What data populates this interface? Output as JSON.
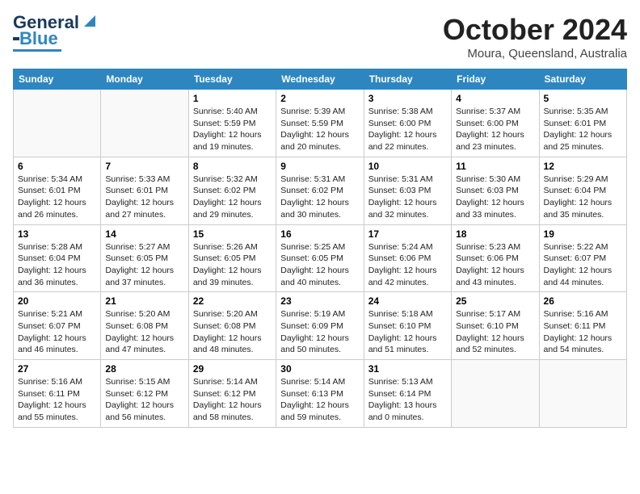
{
  "logo": {
    "line1": "General",
    "line2": "Blue"
  },
  "title": "October 2024",
  "location": "Moura, Queensland, Australia",
  "weekdays": [
    "Sunday",
    "Monday",
    "Tuesday",
    "Wednesday",
    "Thursday",
    "Friday",
    "Saturday"
  ],
  "weeks": [
    [
      {
        "day": "",
        "info": ""
      },
      {
        "day": "",
        "info": ""
      },
      {
        "day": "1",
        "info": "Sunrise: 5:40 AM\nSunset: 5:59 PM\nDaylight: 12 hours\nand 19 minutes."
      },
      {
        "day": "2",
        "info": "Sunrise: 5:39 AM\nSunset: 5:59 PM\nDaylight: 12 hours\nand 20 minutes."
      },
      {
        "day": "3",
        "info": "Sunrise: 5:38 AM\nSunset: 6:00 PM\nDaylight: 12 hours\nand 22 minutes."
      },
      {
        "day": "4",
        "info": "Sunrise: 5:37 AM\nSunset: 6:00 PM\nDaylight: 12 hours\nand 23 minutes."
      },
      {
        "day": "5",
        "info": "Sunrise: 5:35 AM\nSunset: 6:01 PM\nDaylight: 12 hours\nand 25 minutes."
      }
    ],
    [
      {
        "day": "6",
        "info": "Sunrise: 5:34 AM\nSunset: 6:01 PM\nDaylight: 12 hours\nand 26 minutes."
      },
      {
        "day": "7",
        "info": "Sunrise: 5:33 AM\nSunset: 6:01 PM\nDaylight: 12 hours\nand 27 minutes."
      },
      {
        "day": "8",
        "info": "Sunrise: 5:32 AM\nSunset: 6:02 PM\nDaylight: 12 hours\nand 29 minutes."
      },
      {
        "day": "9",
        "info": "Sunrise: 5:31 AM\nSunset: 6:02 PM\nDaylight: 12 hours\nand 30 minutes."
      },
      {
        "day": "10",
        "info": "Sunrise: 5:31 AM\nSunset: 6:03 PM\nDaylight: 12 hours\nand 32 minutes."
      },
      {
        "day": "11",
        "info": "Sunrise: 5:30 AM\nSunset: 6:03 PM\nDaylight: 12 hours\nand 33 minutes."
      },
      {
        "day": "12",
        "info": "Sunrise: 5:29 AM\nSunset: 6:04 PM\nDaylight: 12 hours\nand 35 minutes."
      }
    ],
    [
      {
        "day": "13",
        "info": "Sunrise: 5:28 AM\nSunset: 6:04 PM\nDaylight: 12 hours\nand 36 minutes."
      },
      {
        "day": "14",
        "info": "Sunrise: 5:27 AM\nSunset: 6:05 PM\nDaylight: 12 hours\nand 37 minutes."
      },
      {
        "day": "15",
        "info": "Sunrise: 5:26 AM\nSunset: 6:05 PM\nDaylight: 12 hours\nand 39 minutes."
      },
      {
        "day": "16",
        "info": "Sunrise: 5:25 AM\nSunset: 6:05 PM\nDaylight: 12 hours\nand 40 minutes."
      },
      {
        "day": "17",
        "info": "Sunrise: 5:24 AM\nSunset: 6:06 PM\nDaylight: 12 hours\nand 42 minutes."
      },
      {
        "day": "18",
        "info": "Sunrise: 5:23 AM\nSunset: 6:06 PM\nDaylight: 12 hours\nand 43 minutes."
      },
      {
        "day": "19",
        "info": "Sunrise: 5:22 AM\nSunset: 6:07 PM\nDaylight: 12 hours\nand 44 minutes."
      }
    ],
    [
      {
        "day": "20",
        "info": "Sunrise: 5:21 AM\nSunset: 6:07 PM\nDaylight: 12 hours\nand 46 minutes."
      },
      {
        "day": "21",
        "info": "Sunrise: 5:20 AM\nSunset: 6:08 PM\nDaylight: 12 hours\nand 47 minutes."
      },
      {
        "day": "22",
        "info": "Sunrise: 5:20 AM\nSunset: 6:08 PM\nDaylight: 12 hours\nand 48 minutes."
      },
      {
        "day": "23",
        "info": "Sunrise: 5:19 AM\nSunset: 6:09 PM\nDaylight: 12 hours\nand 50 minutes."
      },
      {
        "day": "24",
        "info": "Sunrise: 5:18 AM\nSunset: 6:10 PM\nDaylight: 12 hours\nand 51 minutes."
      },
      {
        "day": "25",
        "info": "Sunrise: 5:17 AM\nSunset: 6:10 PM\nDaylight: 12 hours\nand 52 minutes."
      },
      {
        "day": "26",
        "info": "Sunrise: 5:16 AM\nSunset: 6:11 PM\nDaylight: 12 hours\nand 54 minutes."
      }
    ],
    [
      {
        "day": "27",
        "info": "Sunrise: 5:16 AM\nSunset: 6:11 PM\nDaylight: 12 hours\nand 55 minutes."
      },
      {
        "day": "28",
        "info": "Sunrise: 5:15 AM\nSunset: 6:12 PM\nDaylight: 12 hours\nand 56 minutes."
      },
      {
        "day": "29",
        "info": "Sunrise: 5:14 AM\nSunset: 6:12 PM\nDaylight: 12 hours\nand 58 minutes."
      },
      {
        "day": "30",
        "info": "Sunrise: 5:14 AM\nSunset: 6:13 PM\nDaylight: 12 hours\nand 59 minutes."
      },
      {
        "day": "31",
        "info": "Sunrise: 5:13 AM\nSunset: 6:14 PM\nDaylight: 13 hours\nand 0 minutes."
      },
      {
        "day": "",
        "info": ""
      },
      {
        "day": "",
        "info": ""
      }
    ]
  ]
}
